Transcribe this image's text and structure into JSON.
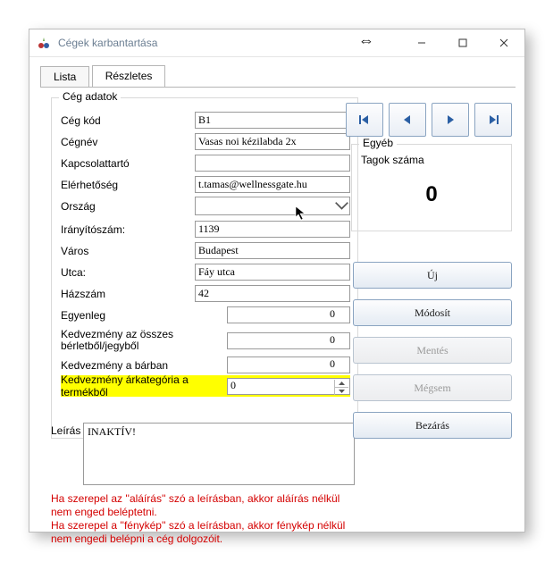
{
  "window": {
    "title": "Cégek karbantartása"
  },
  "tabs": {
    "lista": "Lista",
    "reszletes": "Részletes"
  },
  "group": {
    "title": "Cég adatok"
  },
  "labels": {
    "ceg_kod": "Cég kód",
    "cegnev": "Cégnév",
    "kapcsolattarto": "Kapcsolattartó",
    "elerhetoseg": "Elérhetőség",
    "orszag": "Ország",
    "iranyitoszam": "Irányítószám:",
    "varos": "Város",
    "utca": "Utca:",
    "hazszam": "Házszám",
    "egyenleg": "Egyenleg",
    "kedv_berlet": "Kedvezmény az összes bérletből/jegyből",
    "kedv_bar": "Kedvezmény a bárban",
    "kedv_arkat": "Kedvezmény árkategória a termékből",
    "leiras": "Leírás"
  },
  "values": {
    "ceg_kod": "B1",
    "cegnev": "Vasas noi kézilabda 2x",
    "kapcsolattarto": "",
    "elerhetoseg": "t.tamas@wellnessgate.hu",
    "orszag": "",
    "iranyitoszam": "1139",
    "varos": "Budapest",
    "utca": "Fáy utca",
    "hazszam": "42",
    "egyenleg": "0",
    "kedv_berlet": "0",
    "kedv_bar": "0",
    "kedv_arkat": "0",
    "leiras": "INAKTÍV!"
  },
  "egyeb": {
    "title": "Egyéb",
    "tagok_label": "Tagok száma",
    "tagok_value": "0"
  },
  "buttons": {
    "uj": "Új",
    "modosit": "Módosít",
    "mentes": "Mentés",
    "megsem": "Mégsem",
    "bezaras": "Bezárás"
  },
  "note": "Ha szerepel az ''aláírás'' szó a leírásban, akkor aláírás nélkül nem enged beléptetni.\nHa szerepel a ''fénykép'' szó a leírásban, akkor fénykép nélkül nem engedi belépni a cég dolgozóit."
}
